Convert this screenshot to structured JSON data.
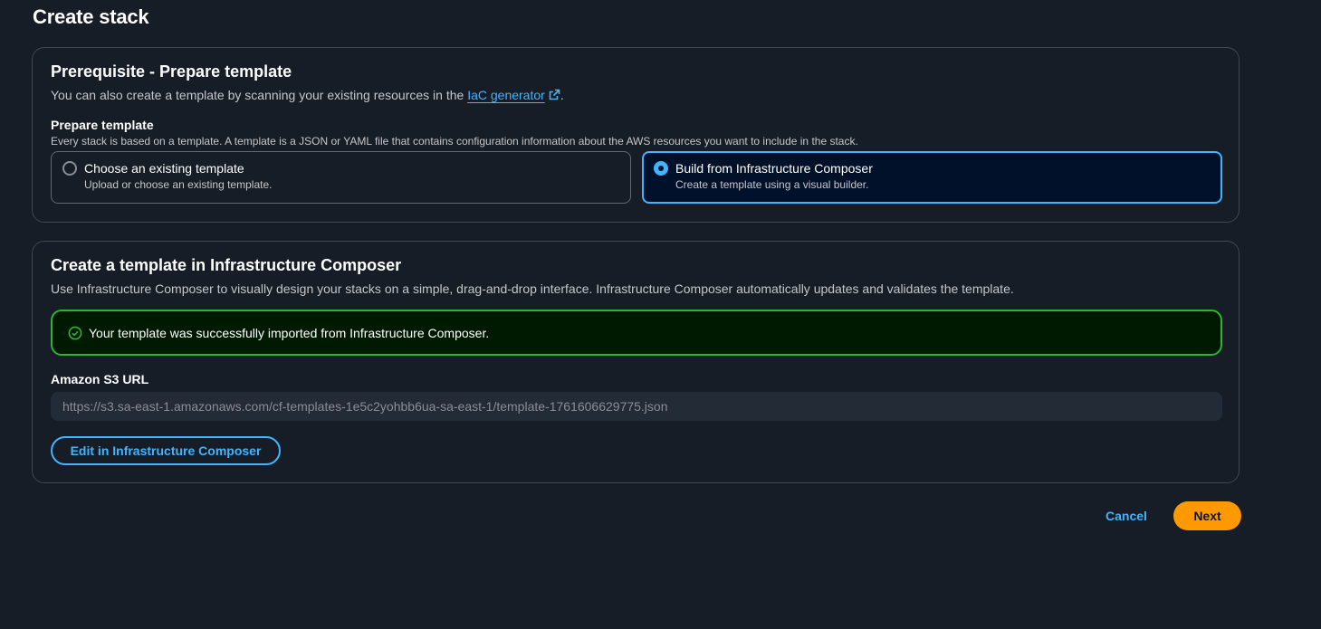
{
  "page": {
    "title": "Create stack"
  },
  "prerequisite": {
    "header": "Prerequisite - Prepare template",
    "desc_prefix": "You can also create a template by scanning your existing resources in the ",
    "link_label": "IaC generator",
    "link_icon": "external-link-icon",
    "desc_suffix": ".",
    "field_label": "Prepare template",
    "field_desc": "Every stack is based on a template. A template is a JSON or YAML file that contains configuration information about the AWS resources you want to include in the stack.",
    "options": [
      {
        "title": "Choose an existing template",
        "subtitle": "Upload or choose an existing template.",
        "selected": false
      },
      {
        "title": "Build from Infrastructure Composer",
        "subtitle": "Create a template using a visual builder.",
        "selected": true
      }
    ]
  },
  "composer": {
    "header": "Create a template in Infrastructure Composer",
    "desc": "Use Infrastructure Composer to visually design your stacks on a simple, drag-and-drop interface. Infrastructure Composer automatically updates and validates the template.",
    "alert_icon": "success-check-icon",
    "alert_text": "Your template was successfully imported from Infrastructure Composer.",
    "url_label": "Amazon S3 URL",
    "url_value": "https://s3.sa-east-1.amazonaws.com/cf-templates-1e5c2yohbb6ua-sa-east-1/template-1761606629775.json",
    "edit_button": "Edit in Infrastructure Composer"
  },
  "actions": {
    "cancel": "Cancel",
    "next": "Next"
  },
  "colors": {
    "background": "#161d26",
    "accent": "#42b4ff",
    "success": "#2bb534",
    "primary_button": "#ff9900",
    "selected_tile": "#001129"
  }
}
